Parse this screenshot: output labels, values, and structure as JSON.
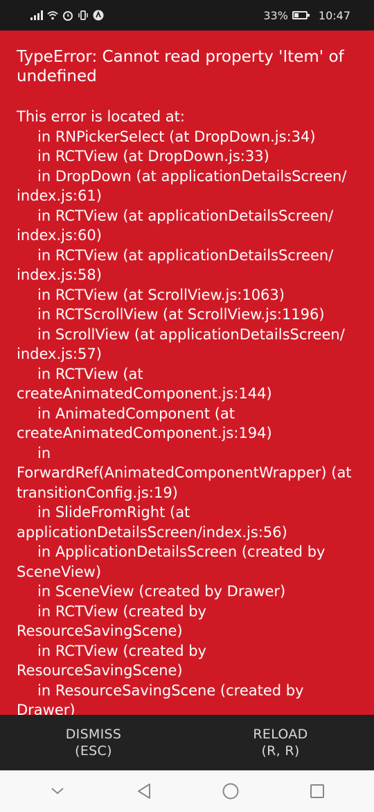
{
  "status_bar": {
    "battery": "33%",
    "battery_level": 0.33,
    "time": "10:47"
  },
  "error": {
    "title": "TypeError: Cannot read property 'Item' of undefined",
    "located_label": "This error is located at:",
    "stack": [
      "in RNPickerSelect (at DropDown.js:34)",
      "in RCTView (at DropDown.js:33)",
      "in DropDown (at applicationDetailsScreen/ index.js:61)",
      "in RCTView (at applicationDetailsScreen/ index.js:60)",
      "in RCTView (at applicationDetailsScreen/ index.js:58)",
      "in RCTView (at ScrollView.js:1063)",
      "in RCTScrollView (at ScrollView.js:1196)",
      "in ScrollView (at applicationDetailsScreen/ index.js:57)",
      "in RCTView (at createAnimatedComponent.js:144)",
      "in AnimatedComponent (at createAnimatedComponent.js:194)",
      "in ForwardRef(AnimatedComponentWrapper) (at transitionConfig.js:19)",
      "in SlideFromRight (at applicationDetailsScreen/index.js:56)",
      "in ApplicationDetailsScreen (created by SceneView)",
      "in SceneView (created by Drawer)",
      "in RCTView (created by ResourceSavingScene)",
      "in RCTView (created by ResourceSavingScene)",
      "in ResourceSavingScene (created by Drawer)"
    ],
    "background_color": "#cf1a26"
  },
  "actions": {
    "dismiss_label": "DISMISS",
    "dismiss_key": "(ESC)",
    "reload_label": "RELOAD",
    "reload_key": "(R, R)"
  },
  "nav": {
    "icons": [
      "chevron-down-icon",
      "back-triangle-icon",
      "home-circle-icon",
      "recents-square-icon"
    ]
  }
}
